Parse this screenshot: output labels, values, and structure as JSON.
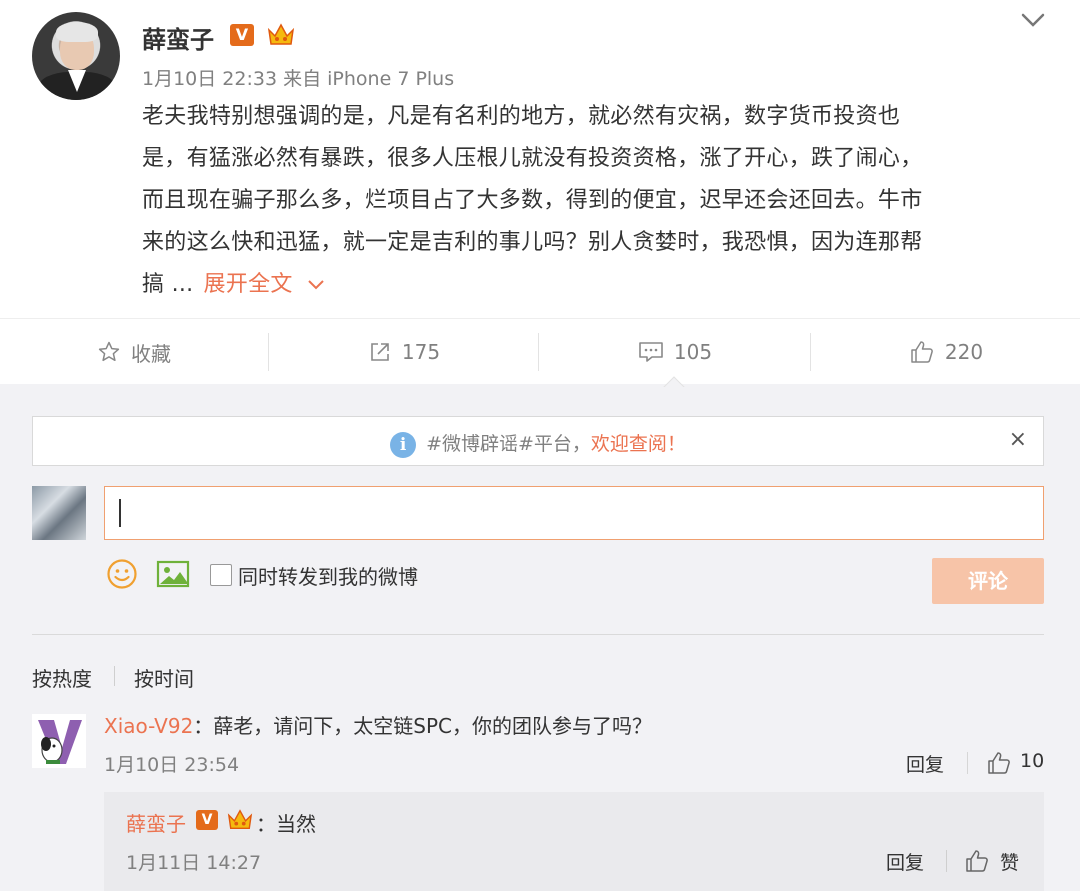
{
  "post": {
    "username": "薛蛮子",
    "verified_badge": "V",
    "meta": "1月10日 22:33 来自 iPhone 7 Plus",
    "content_lines": [
      "老夫我特别想强调的是，凡是有名利的地方，就必然有灾祸，数字货币投资也",
      "是，有猛涨必然有暴跌，很多人压根儿就没有投资资格，涨了开心，跌了闹心，",
      "而且现在骗子那么多，烂项目占了大多数，得到的便宜，迟早还会还回去。牛市",
      "来的这么快和迅猛，就一定是吉利的事儿吗？别人贪婪时，我恐惧，因为连那帮"
    ],
    "content_last": "搞 ...",
    "expand_label": "展开全文",
    "icons": [
      "avatar",
      "verified-v-icon",
      "crown-icon",
      "chevron-down-icon"
    ]
  },
  "actions": {
    "favorite_label": "收藏",
    "repost_count": "175",
    "comment_count": "105",
    "like_count": "220",
    "icons": [
      "star-icon",
      "share-icon",
      "comment-icon",
      "thumbs-up-icon"
    ]
  },
  "notice": {
    "tag_text": "#微博辟谣#平台，",
    "link_text": "欢迎查阅！",
    "close": "×",
    "info_glyph": "i"
  },
  "composer": {
    "input_value": "",
    "repost_label": "同时转发到我的微博",
    "submit_label": "评论",
    "icons": [
      "emoji-icon",
      "image-icon"
    ]
  },
  "sort": {
    "hot": "按热度",
    "time": "按时间"
  },
  "comments": [
    {
      "name": "Xiao-V92",
      "text": "：薛老，请问下，太空链SPC，你的团队参与了吗？",
      "time": "1月10日 23:54",
      "reply_label": "回复",
      "likes": "10",
      "replies": [
        {
          "name": "薛蛮子",
          "badge": "V",
          "text": "：当然",
          "time": "1月11日 14:27",
          "reply_label": "回复",
          "like_label": "赞"
        }
      ]
    }
  ],
  "colors": {
    "accent": "#eb7350",
    "verified": "#e46b1b",
    "submit_disabled": "#f7c4a8",
    "muted_text": "#808080",
    "page_bg": "#f2f2f5"
  }
}
